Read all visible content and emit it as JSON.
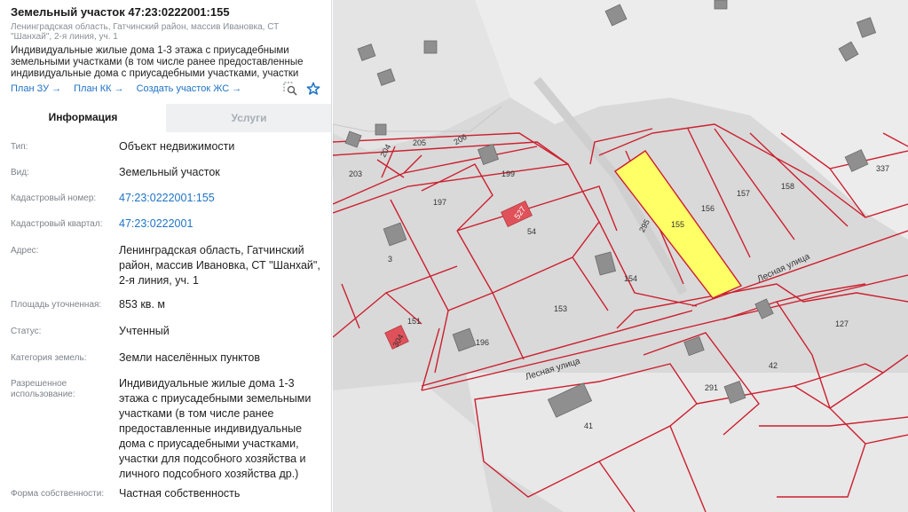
{
  "header": {
    "title": "Земельный участок 47:23:0222001:155",
    "address_small": "Ленинградская область, Гатчинский район, массив Ивановка, СТ \"Шанхай\", 2-я линия, уч. 1",
    "description": "Индивидуальные жилые дома 1-3 этажа с приусадебными земельными участками (в том числе ранее предоставленные индивидуальные дома с приусадебными участками, участки для...",
    "links": [
      "План ЗУ →",
      "План КК →",
      "Создать участок ЖС →"
    ],
    "tool_icons": [
      "search-area-icon",
      "star-icon"
    ]
  },
  "tabs": [
    {
      "label": "Информация",
      "active": true
    },
    {
      "label": "Услуги",
      "active": false
    }
  ],
  "properties": [
    {
      "label": "Тип:",
      "value": "Объект недвижимости",
      "link": false
    },
    {
      "label": "Вид:",
      "value": "Земельный участок",
      "link": false
    },
    {
      "label": "Кадастровый номер:",
      "value": "47:23:0222001:155",
      "link": true
    },
    {
      "label": "Кадастровый квартал:",
      "value": "47:23:0222001",
      "link": true
    },
    {
      "label": "Адрес:",
      "value": "Ленинградская область, Гатчинский район, массив Ивановка, СТ \"Шанхай\", 2-я линия, уч. 1",
      "link": false
    },
    {
      "label": "Площадь уточненная:",
      "value": "853 кв. м",
      "link": false
    },
    {
      "label": "Статус:",
      "value": "Учтенный",
      "link": false
    },
    {
      "label": "Категория земель:",
      "value": "Земли населённых пунктов",
      "link": false
    },
    {
      "label": "Разрешенное использование:",
      "value": "Индивидуальные жилые дома 1-3 этажа с приусадебными земельными участками (в том числе ранее предоставленные индивидуальные дома с приусадебными участками, участки для подсобного хозяйства и личного подсобного хозяйства др.)",
      "link": false
    },
    {
      "label": "Форма собственности:",
      "value": "Частная собственность",
      "link": false
    }
  ],
  "map": {
    "streets": [
      "Лесная улица",
      "Лесная улица"
    ],
    "parcels": [
      "203",
      "204",
      "205",
      "206",
      "199",
      "197",
      "527",
      "54",
      "3",
      "295",
      "155",
      "156",
      "157",
      "158",
      "337",
      "154",
      "153",
      "151",
      "196",
      "304",
      "127",
      "42",
      "291",
      "41"
    ],
    "colors": {
      "boundary": "#cc1f2e",
      "selected_fill": "#ffff66",
      "building": "#8f8f8f",
      "building_red": "#e0525a"
    }
  }
}
